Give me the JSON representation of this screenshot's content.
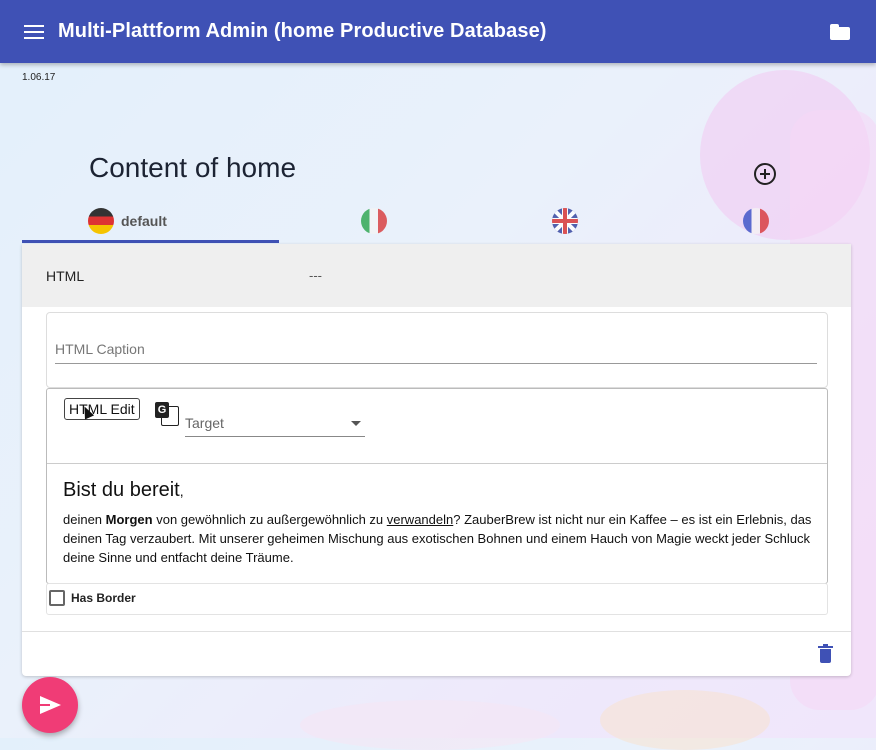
{
  "app": {
    "title": "Multi-Plattform Admin (home Productive Database)",
    "version": "1.06.17",
    "bar_color": "#3f51b5",
    "accent_color": "#f03c76"
  },
  "page": {
    "title": "Content of home"
  },
  "tabs": [
    {
      "label": "default",
      "flag": "german-flag-icon",
      "active": true
    },
    {
      "label": "",
      "flag": "italian-flag-icon",
      "active": false
    },
    {
      "label": "",
      "flag": "uk-flag-icon",
      "active": false
    },
    {
      "label": "",
      "flag": "french-flag-icon",
      "active": false
    }
  ],
  "card": {
    "header_title": "HTML",
    "header_value": "---",
    "caption_placeholder": "HTML Caption",
    "editor": {
      "html_edit_label": "HTML Edit",
      "target_select": "Target",
      "heading": "Bist du bereit",
      "heading_suffix": ",",
      "text_part1": "deinen ",
      "text_bold": "Morgen",
      "text_part2": " von gewöhnlich zu außergewöhnlich zu ",
      "text_link": "verwandeln",
      "text_part3": "? ZauberBrew ist nicht nur ein Kaffee – es ist ein Erlebnis, das deinen Tag verzaubert. Mit unserer geheimen Mischung aus exotischen Bohnen und einem Hauch von Magie weckt jeder Schluck deine Sinne und entfacht deine Träume."
    },
    "has_border_label": "Has Border",
    "has_border_checked": false
  },
  "icons": {
    "menu": "menu-icon",
    "folder": "folder-icon",
    "add": "add-circle-icon",
    "translate": "translate-icon",
    "trash": "trash-icon",
    "send": "send-icon"
  }
}
